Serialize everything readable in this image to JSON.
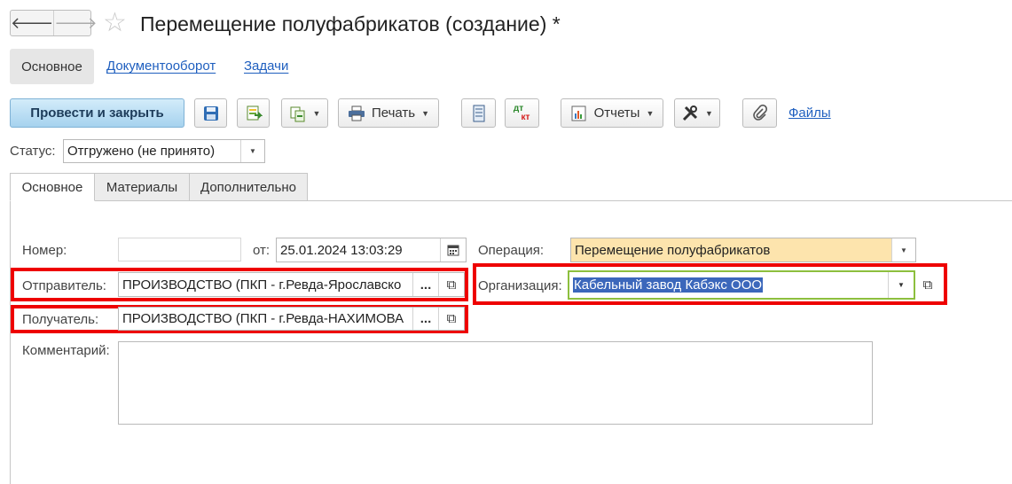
{
  "nav": {
    "back_icon": "arrow-left-icon",
    "forward_icon": "arrow-right-icon"
  },
  "title": "Перемещение полуфабрикатов (создание) *",
  "sections": {
    "main": "Основное",
    "docflow": "Документооборот",
    "tasks": "Задачи"
  },
  "toolbar": {
    "post_close": "Провести и закрыть",
    "print": "Печать",
    "reports": "Отчеты",
    "files": "Файлы",
    "dtkt_top": "дт",
    "dtkt_bottom": "кт"
  },
  "status": {
    "label": "Статус:",
    "value": "Отгружено (не принято)"
  },
  "tabs": [
    "Основное",
    "Материалы",
    "Дополнительно"
  ],
  "form": {
    "number_label": "Номер:",
    "number_value": "",
    "date_label": "от:",
    "date_value": "25.01.2024 13:03:29",
    "operation_label": "Операция:",
    "operation_value": "Перемещение полуфабрикатов",
    "sender_label": "Отправитель:",
    "sender_value": "ПРОИЗВОДСТВО (ПКП - г.Ревда-Ярославско",
    "org_label": "Организация:",
    "org_value": "Кабельный завод Кабэкс ООО",
    "receiver_label": "Получатель:",
    "receiver_value": "ПРОИЗВОДСТВО (ПКП - г.Ревда-НАХИМОВА",
    "comment_label": "Комментарий:",
    "comment_value": "",
    "ellipsis": "..."
  },
  "colors": {
    "highlight": "#ee0000",
    "primary_button": "#b9def4",
    "operation_bg": "#fde4ad",
    "selection": "#3b67bb",
    "link": "#1f5fbf"
  }
}
